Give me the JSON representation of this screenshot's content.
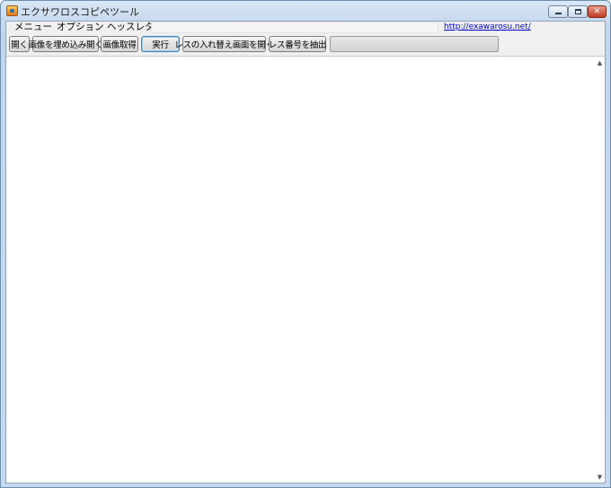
{
  "window": {
    "title": "エクサワロスコピペツール"
  },
  "caption": {
    "minimize": "—",
    "maximize": "□",
    "close": "✕"
  },
  "menu": {
    "items": [
      "メニュー",
      "オプション"
    ]
  },
  "title_field": {
    "label": "ヘッスレタイ:",
    "value": ""
  },
  "link": {
    "text": "http://exawarosu.net/"
  },
  "toolbar": {
    "buttons": [
      "開く",
      "画像を埋め込み開く",
      "画像取得",
      "実行",
      "レスの入れ替え画面を開く",
      "レス番号を抽出"
    ]
  },
  "progress": {
    "value": 0
  },
  "scroll": {
    "up": "▲",
    "down": "▼"
  }
}
